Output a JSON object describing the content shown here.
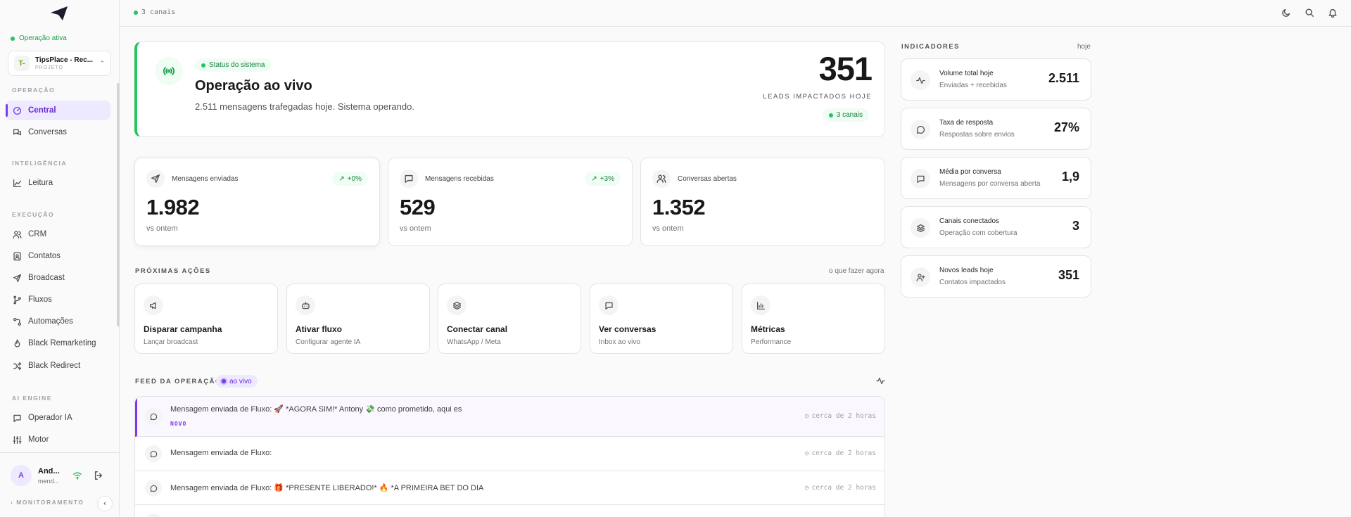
{
  "sidebar": {
    "status": "Operação ativa",
    "project": {
      "initial": "T-",
      "name": "TipsPlace - Rec...",
      "sub": "PROJETO"
    },
    "sections": {
      "operacao": "OPERAÇÃO",
      "inteligencia": "INTELIGÊNCIA",
      "execucao": "EXECUÇÃO",
      "ai_engine": "AI ENGINE"
    },
    "items": {
      "central": "Central",
      "conversas": "Conversas",
      "leitura": "Leitura",
      "crm": "CRM",
      "contatos": "Contatos",
      "broadcast": "Broadcast",
      "fluxos": "Fluxos",
      "automacoes": "Automações",
      "black_remarketing": "Black Remarketing",
      "black_redirect": "Black Redirect",
      "operador_ia": "Operador IA",
      "motor": "Motor"
    },
    "user": {
      "initial": "A",
      "name": "And...",
      "email": "mend..."
    },
    "monitoring": "MONITORAMENTO",
    "collapse_icon": "chevron-left-icon"
  },
  "topbar": {
    "channels": "3 canais"
  },
  "hero": {
    "badge": "Status do sistema",
    "title": "Operação ao vivo",
    "description": "2.511 mensagens trafegadas hoje. Sistema operando.",
    "number": "351",
    "number_label": "LEADS IMPACTADOS HOJE",
    "channels": "3 canais"
  },
  "metrics": [
    {
      "label": "Mensagens enviadas",
      "trend": "+0%",
      "value": "1.982",
      "sub": "vs ontem"
    },
    {
      "label": "Mensagens recebidas",
      "trend": "+3%",
      "value": "529",
      "sub": "vs ontem"
    },
    {
      "label": "Conversas abertas",
      "value": "1.352",
      "sub": "vs ontem"
    }
  ],
  "next_actions": {
    "title": "PRÓXIMAS AÇÕES",
    "right": "o que fazer agora",
    "items": [
      {
        "title": "Disparar campanha",
        "sub": "Lançar broadcast"
      },
      {
        "title": "Ativar fluxo",
        "sub": "Configurar agente IA"
      },
      {
        "title": "Conectar canal",
        "sub": "WhatsApp / Meta"
      },
      {
        "title": "Ver conversas",
        "sub": "Inbox ao vivo"
      },
      {
        "title": "Métricas",
        "sub": "Performance"
      }
    ]
  },
  "feed": {
    "title": "FEED DA OPERAÇÃO",
    "badge": "ao vivo",
    "rows": [
      {
        "text": "Mensagem enviada de Fluxo: 🚀 *AGORA SIM!* Antony 💸 como prometido, aqui es",
        "tag": "NOVO",
        "time": "cerca de 2 horas"
      },
      {
        "text": "Mensagem enviada de Fluxo:",
        "time": "cerca de 2 horas"
      },
      {
        "text": "Mensagem enviada de Fluxo: 🎁 *PRESENTE LIBERADO!* 🔥 *A PRIMEIRA BET DO DIA",
        "time": "cerca de 2 horas"
      }
    ]
  },
  "indicators": {
    "title": "INDICADORES",
    "right": "hoje",
    "items": [
      {
        "title": "Volume total hoje",
        "sub": "Enviadas + recebidas",
        "value": "2.511"
      },
      {
        "title": "Taxa de resposta",
        "sub": "Respostas sobre envios",
        "value": "27%"
      },
      {
        "title": "Média por conversa",
        "sub": "Mensagens por conversa aberta",
        "value": "1,9"
      },
      {
        "title": "Canais conectados",
        "sub": "Operação com cobertura",
        "value": "3"
      },
      {
        "title": "Novos leads hoje",
        "sub": "Contatos impactados",
        "value": "351"
      }
    ]
  },
  "colors": {
    "accent": "#7c3aed",
    "success": "#22c55e"
  }
}
